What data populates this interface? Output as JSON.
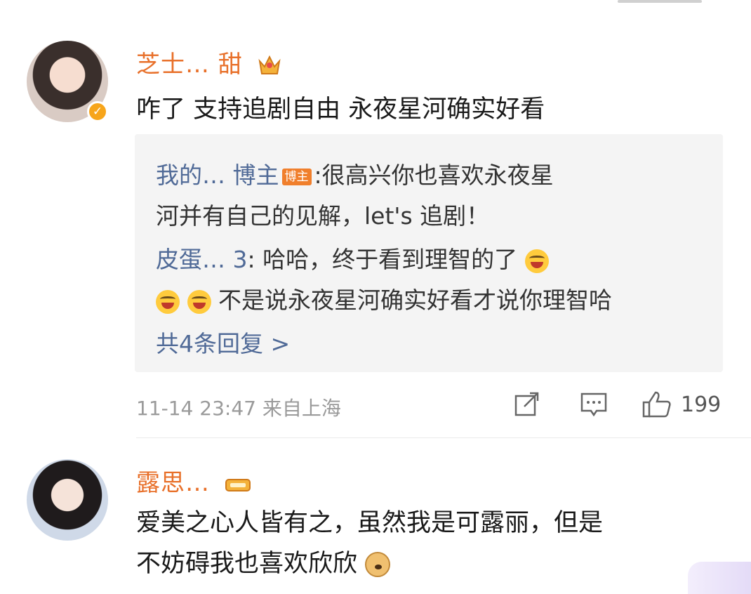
{
  "comments": [
    {
      "username": "芝士… 甜",
      "text": "咋了 支持追剧自由 永夜星河确实好看",
      "replies": [
        {
          "name": "我的… 博主",
          "blogger_tag": "博主",
          "line1": ":很高兴你也喜欢永夜星",
          "line2": "河并有自己的见解，let's 追剧！"
        },
        {
          "name": "皮蛋… 3",
          "line1": ": 哈哈，终于看到理智的了",
          "line2": "不是说永夜星河确实好看才说你理智哈"
        }
      ],
      "more_replies": "共4条回复 >",
      "time_location": "11-14 23:47 来自上海",
      "like_count": "199"
    },
    {
      "username": "露思…",
      "text_line1": "爱美之心人皆有之，虽然我是可露丽，但是",
      "text_line2": "不妨碍我也喜欢欣欣"
    }
  ],
  "icons": {
    "verified": "verified-icon",
    "share": "share-icon",
    "comment": "comment-icon",
    "like": "thumb-up-icon"
  },
  "colors": {
    "username": "#e8702a",
    "reply_name": "#506a97",
    "reply_bg": "#f4f4f4",
    "meta": "#9a9a9a"
  }
}
